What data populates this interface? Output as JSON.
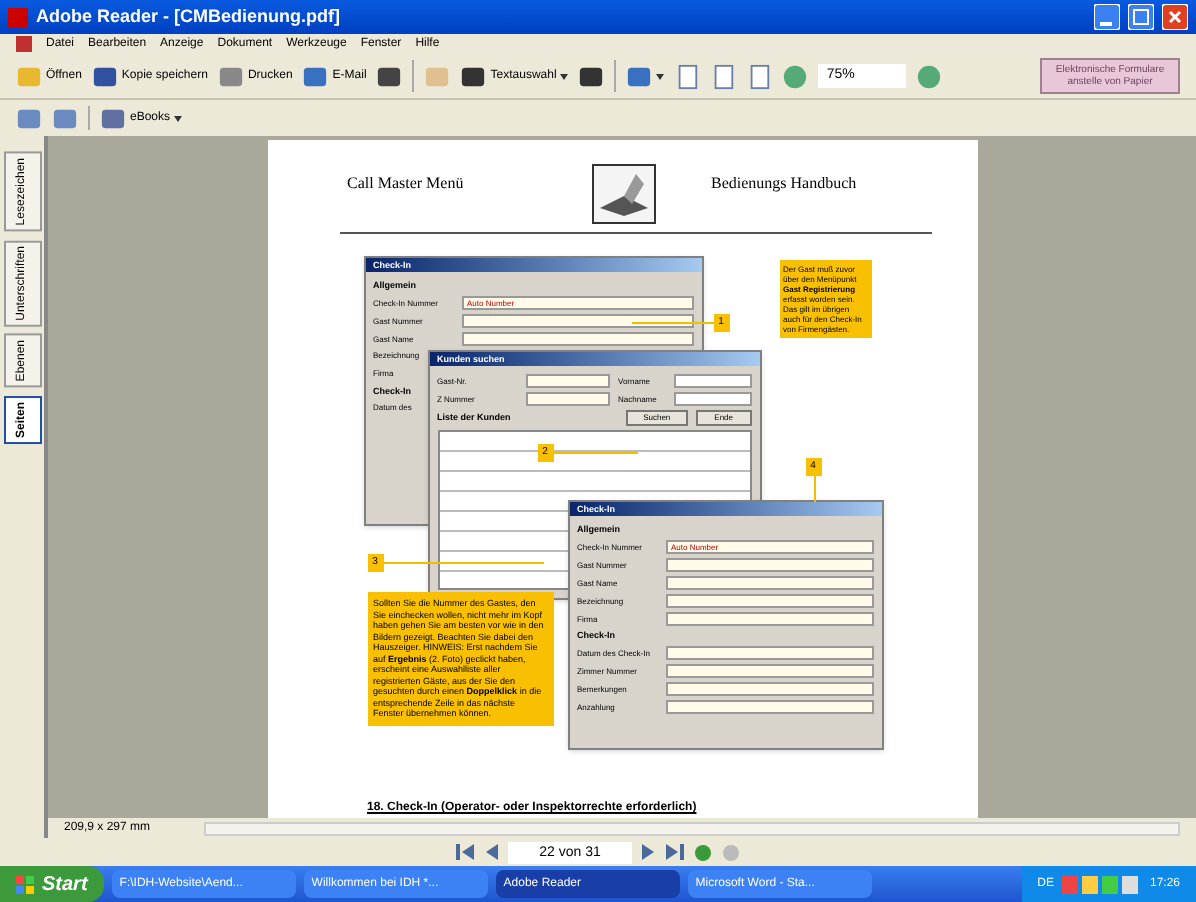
{
  "window": {
    "title": "Adobe Reader - [CMBedienung.pdf]"
  },
  "menu": [
    "Datei",
    "Bearbeiten",
    "Anzeige",
    "Dokument",
    "Werkzeuge",
    "Fenster",
    "Hilfe"
  ],
  "toolbar": [
    {
      "kind": "button",
      "label": "Öffnen"
    },
    {
      "kind": "button",
      "label": "Kopie speichern"
    },
    {
      "kind": "button",
      "label": "Drucken"
    },
    {
      "kind": "button",
      "label": "E-Mail"
    },
    {
      "kind": "button"
    },
    {
      "kind": "separator"
    },
    {
      "kind": "button"
    },
    {
      "kind": "dropdown",
      "label": "Textauswahl"
    },
    {
      "kind": "button"
    },
    {
      "kind": "separator"
    },
    {
      "kind": "dropdown"
    },
    {
      "kind": "button"
    },
    {
      "kind": "button"
    },
    {
      "kind": "button"
    },
    {
      "kind": "button"
    },
    {
      "kind": "zoom",
      "label": "75%"
    },
    {
      "kind": "button"
    }
  ],
  "promo": "Elektronische Formulare anstelle von Papier",
  "toolbar2": [
    {
      "kind": "button"
    },
    {
      "kind": "button"
    },
    {
      "kind": "separator"
    },
    {
      "kind": "dropdown",
      "label": "eBooks"
    }
  ],
  "nav_tabs": [
    {
      "label": "Lesezeichen",
      "selected": false
    },
    {
      "label": "Unterschriften",
      "selected": false
    },
    {
      "label": "Ebenen",
      "selected": false
    },
    {
      "label": "Seiten",
      "selected": true
    }
  ],
  "page": {
    "header_left": "Call Master Menü",
    "header_right": "Bedienungs Handbuch",
    "dialogs": [
      {
        "title": "Check-In",
        "rows": [
          {
            "kind": "section",
            "label": "Allgemein"
          },
          {
            "kind": "field",
            "label": "Check-In Nummer",
            "value": "Auto Number"
          },
          {
            "kind": "field",
            "label": "Gast Nummer"
          },
          {
            "kind": "field",
            "label": "Gast Name"
          },
          {
            "kind": "label",
            "label": "Bezeichnung"
          },
          {
            "kind": "label",
            "label": "Firma"
          },
          {
            "kind": "section",
            "label": "Check-In"
          },
          {
            "kind": "label",
            "label": "Datum des"
          }
        ]
      },
      {
        "title": "Kunden suchen",
        "rows": [
          {
            "kind": "field",
            "label": "Gast-Nr.",
            "label2": "Vorname"
          },
          {
            "kind": "field",
            "label": "Z Nummer",
            "label2": "Nachname"
          },
          {
            "kind": "table",
            "label": "Liste der Kunden",
            "buttons": [
              "Suchen",
              "Ende"
            ]
          }
        ]
      },
      {
        "title": "Check-In",
        "rows": [
          {
            "kind": "section",
            "label": "Allgemein"
          },
          {
            "kind": "field",
            "label": "Check-In Nummer",
            "value": "Auto Number"
          },
          {
            "kind": "field",
            "label": "Gast Nummer"
          },
          {
            "kind": "field",
            "label": "Gast Name"
          },
          {
            "kind": "field",
            "label": "Bezeichnung"
          },
          {
            "kind": "field",
            "label": "Firma"
          },
          {
            "kind": "section",
            "label": "Check-In"
          },
          {
            "kind": "field",
            "label": "Datum des Check-In"
          },
          {
            "kind": "field",
            "label": "Zimmer Nummer"
          },
          {
            "kind": "field",
            "label": "Bemerkungen"
          },
          {
            "kind": "field",
            "label": "Anzahlung"
          }
        ]
      }
    ],
    "callouts": [
      "1",
      "2",
      "3",
      "4"
    ],
    "note_right": "Der Gast muß zuvor über den Menüpunkt **Gast Registrierung** erfasst worden sein. Das gilt im übrigen auch für den Check-In von Firmengästen.",
    "note_left": "Sollten Sie die Nummer des Gastes, den Sie einchecken wollen, nicht mehr im Kopf haben gehen Sie am besten vor wie in den Bildern gezeigt. Beachten Sie dabei den Hauszeiger. HINWEIS: Erst nachdem Sie auf **Ergebnis** (2. Foto) geclickt haben, erscheint eine Auswahlliste aller registrierten Gäste, aus der Sie den gesuchten durch einen **Doppelklick** in die entsprechende Zeile in das nächste Fenster übernehmen können.",
    "heading": "18. Check-In (Operator- oder Inspektorrechte erforderlich)"
  },
  "page_size": "209,9 x 297 mm",
  "page_nav": "22 von 31",
  "taskbar": {
    "start": "Start",
    "items": [
      {
        "label": "F:\\IDH-Website\\Aend...",
        "selected": false
      },
      {
        "label": "Willkommen bei IDH *...",
        "selected": false
      },
      {
        "label": "Adobe Reader",
        "selected": true
      },
      {
        "label": "Microsoft Word - Sta...",
        "selected": false
      }
    ],
    "lang": "DE",
    "time": "17:26"
  }
}
